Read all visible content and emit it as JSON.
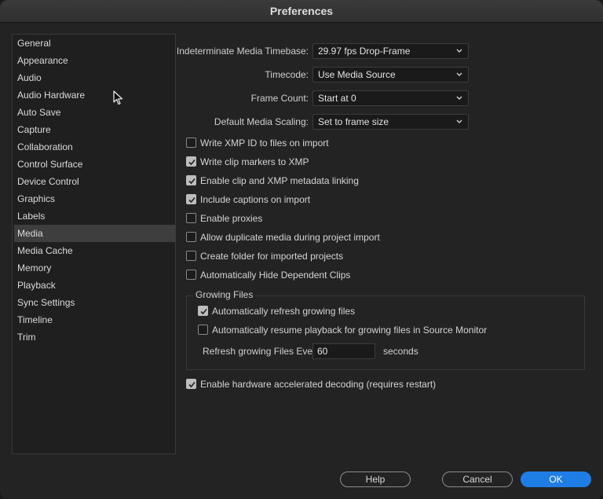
{
  "window": {
    "title": "Preferences"
  },
  "sidebar": {
    "items": [
      {
        "label": "General",
        "selected": false
      },
      {
        "label": "Appearance",
        "selected": false
      },
      {
        "label": "Audio",
        "selected": false
      },
      {
        "label": "Audio Hardware",
        "selected": false
      },
      {
        "label": "Auto Save",
        "selected": false
      },
      {
        "label": "Capture",
        "selected": false
      },
      {
        "label": "Collaboration",
        "selected": false
      },
      {
        "label": "Control Surface",
        "selected": false
      },
      {
        "label": "Device Control",
        "selected": false
      },
      {
        "label": "Graphics",
        "selected": false
      },
      {
        "label": "Labels",
        "selected": false
      },
      {
        "label": "Media",
        "selected": true
      },
      {
        "label": "Media Cache",
        "selected": false
      },
      {
        "label": "Memory",
        "selected": false
      },
      {
        "label": "Playback",
        "selected": false
      },
      {
        "label": "Sync Settings",
        "selected": false
      },
      {
        "label": "Timeline",
        "selected": false
      },
      {
        "label": "Trim",
        "selected": false
      }
    ]
  },
  "media": {
    "timebase": {
      "label": "Indeterminate Media Timebase:",
      "value": "29.97 fps Drop-Frame"
    },
    "timecode": {
      "label": "Timecode:",
      "value": "Use Media Source"
    },
    "frame_count": {
      "label": "Frame Count:",
      "value": "Start at 0"
    },
    "scaling": {
      "label": "Default Media Scaling:",
      "value": "Set to frame size"
    },
    "checkboxes": [
      {
        "label": "Write XMP ID to files on import",
        "checked": false
      },
      {
        "label": "Write clip markers to XMP",
        "checked": true
      },
      {
        "label": "Enable clip and XMP metadata linking",
        "checked": true
      },
      {
        "label": "Include captions on import",
        "checked": true
      },
      {
        "label": "Enable proxies",
        "checked": false
      },
      {
        "label": "Allow duplicate media during project import",
        "checked": false
      },
      {
        "label": "Create folder for imported projects",
        "checked": false
      },
      {
        "label": "Automatically Hide Dependent Clips",
        "checked": false
      }
    ],
    "growing": {
      "title": "Growing Files",
      "auto_refresh": {
        "label": "Automatically refresh growing files",
        "checked": true
      },
      "auto_resume": {
        "label": "Automatically resume playback for growing files in Source Monitor",
        "checked": false
      },
      "refresh_label": "Refresh growing Files Every",
      "refresh_value": "60",
      "refresh_unit": "seconds"
    },
    "hw_decode": {
      "label": "Enable hardware accelerated decoding (requires restart)",
      "checked": true
    }
  },
  "buttons": {
    "help": "Help",
    "cancel": "Cancel",
    "ok": "OK"
  },
  "colors": {
    "accent": "#1f7de6",
    "selected_item": "#3e3e3e"
  }
}
